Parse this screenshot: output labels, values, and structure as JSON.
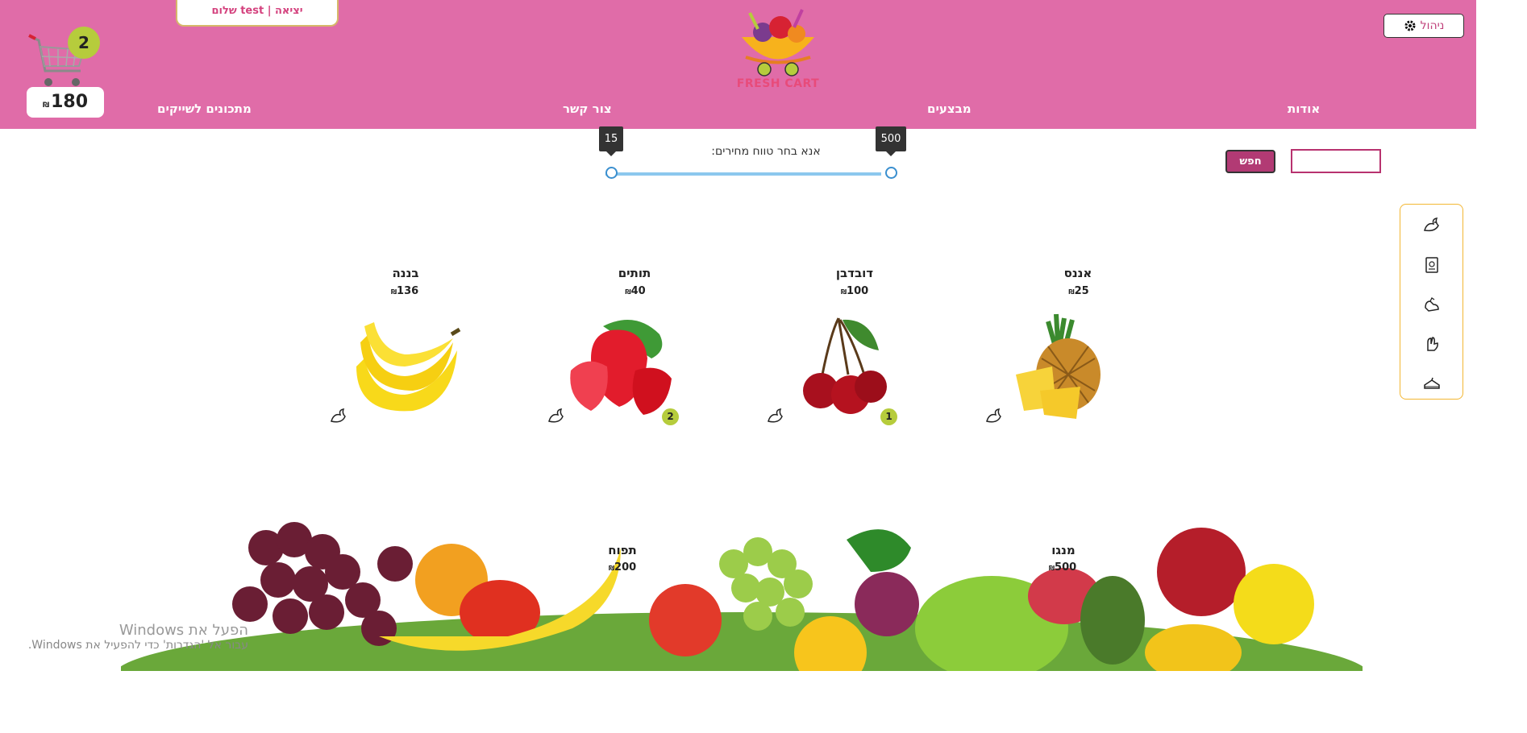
{
  "header": {
    "greeting": "יציאה | test שלום",
    "admin_label": "ניהול",
    "logo_text": "FRESH CART",
    "nav": {
      "about": "אודות",
      "deals": "מבצעים",
      "contact": "צור קשר",
      "recipes": "מתכונים לשייקים"
    },
    "cart": {
      "count": "2",
      "total": "180",
      "currency": "₪"
    }
  },
  "search": {
    "button_label": "חפש",
    "placeholder": ""
  },
  "price_range": {
    "label": "אנא בחר טווח מחירים:",
    "min": "15",
    "max": "500",
    "min_value": 15,
    "max_value": 500
  },
  "products": [
    {
      "name": "אננס",
      "price": "25",
      "currency": "₪",
      "qty": ""
    },
    {
      "name": "דובדבן",
      "price": "100",
      "currency": "₪",
      "qty": "1"
    },
    {
      "name": "תותים",
      "price": "40",
      "currency": "₪",
      "qty": "2"
    },
    {
      "name": "בננה",
      "price": "136",
      "currency": "₪",
      "qty": ""
    },
    {
      "name": "מנגו",
      "price": "500",
      "currency": "₪"
    },
    {
      "name": "תפוח",
      "price": "200",
      "currency": "₪"
    }
  ],
  "side_icons": [
    "dove-icon",
    "book-icon",
    "hands-icon",
    "hand-icon",
    "cake-icon"
  ],
  "watermark": {
    "line1": "הפעל את Windows",
    "line2": "עבור אל 'הגדרות' כדי להפעיל את Windows."
  },
  "colors": {
    "header": "#e06ca8",
    "accent": "#b23a74",
    "badge": "#b6cc3c",
    "panel_border": "#f3b733"
  }
}
